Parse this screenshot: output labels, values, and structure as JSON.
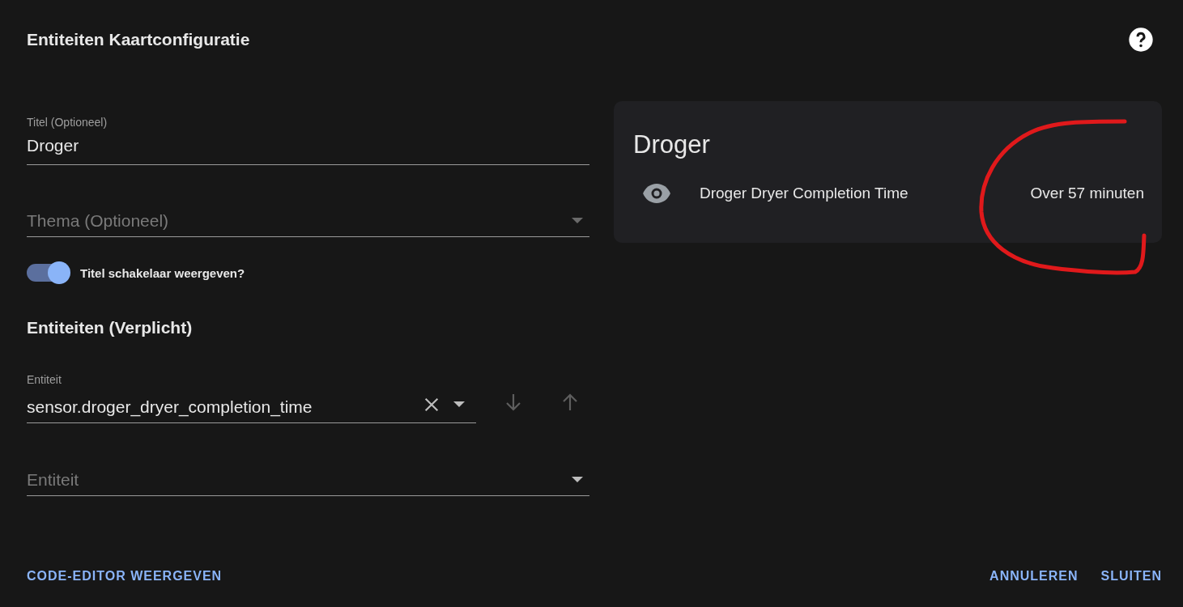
{
  "dialog": {
    "title": "Entiteiten Kaartconfiguratie"
  },
  "form": {
    "title_field": {
      "label": "Titel (Optioneel)",
      "value": "Droger"
    },
    "theme_field": {
      "placeholder": "Thema (Optioneel)"
    },
    "toggle": {
      "label": "Titel schakelaar weergeven?",
      "on": true
    },
    "entities_heading": "Entiteiten (Verplicht)",
    "entities": [
      {
        "label": "Entiteit",
        "value": "sensor.droger_dryer_completion_time"
      }
    ],
    "new_entity": {
      "placeholder": "Entiteit"
    }
  },
  "preview": {
    "title": "Droger",
    "rows": [
      {
        "name": "Droger Dryer Completion Time",
        "state": "Over 57 minuten"
      }
    ]
  },
  "annotation": {
    "kind": "freehand-loop"
  },
  "buttons": {
    "left": [
      {
        "label": "CODE-EDITOR WEERGEVEN"
      }
    ],
    "right": [
      {
        "label": "ANNULEREN"
      },
      {
        "label": "SLUITEN"
      }
    ]
  }
}
